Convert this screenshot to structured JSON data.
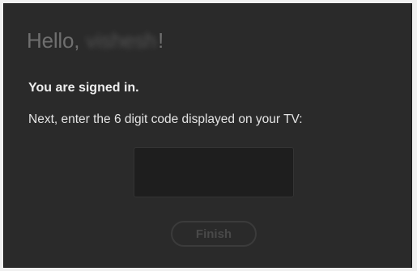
{
  "dialog": {
    "greeting_prefix": "Hello,",
    "username": "vishesh",
    "greeting_suffix": "!",
    "signed_in_text": "You are signed in.",
    "instruction_text": "Next, enter the 6 digit code displayed on your TV:",
    "code_input": {
      "value": "",
      "placeholder": ""
    },
    "finish_label": "Finish",
    "finish_disabled": true
  },
  "colors": {
    "background": "#2a2a2a",
    "text": "#e4e4e4",
    "greeting": "#6f6f6f",
    "input_background": "#1e1e1e",
    "button_disabled": "#494949"
  }
}
